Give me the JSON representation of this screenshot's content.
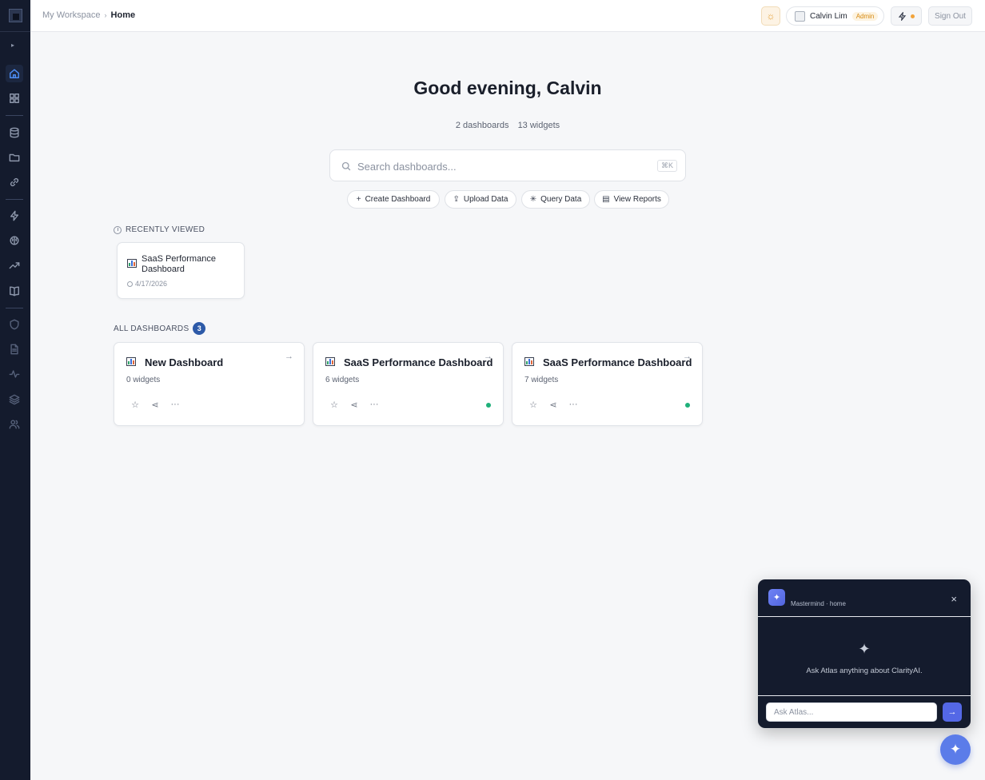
{
  "header": {
    "breadcrumb": {
      "workspace": "My Workspace",
      "separator": "›",
      "current": "Home"
    },
    "user": {
      "name": "Calvin Lim",
      "role": "Admin"
    },
    "sign_out": "Sign Out"
  },
  "main": {
    "greeting": "Good evening, Calvin",
    "stats": {
      "dashboards": "2 dashboards",
      "widgets": "13 widgets"
    },
    "search": {
      "placeholder": "Search dashboards...",
      "shortcut": "⌘K"
    },
    "actions": [
      {
        "label": "Create Dashboard",
        "icon": "plus-icon"
      },
      {
        "label": "Upload Data",
        "icon": "upload-icon"
      },
      {
        "label": "Query Data",
        "icon": "sparkle-icon"
      },
      {
        "label": "View Reports",
        "icon": "document-icon"
      }
    ],
    "recently_viewed": {
      "label": "RECENTLY VIEWED",
      "items": [
        {
          "title": "SaaS Performance Dashboard",
          "date": "4/17/2026"
        }
      ]
    },
    "all_dashboards": {
      "label": "ALL DASHBOARDS",
      "count": "3",
      "items": [
        {
          "title": "New Dashboard",
          "widgets": "0 widgets",
          "active": false
        },
        {
          "title": "SaaS Performance Dashboard",
          "widgets": "6 widgets",
          "active": true
        },
        {
          "title": "SaaS Performance Dashboard",
          "widgets": "7 widgets",
          "active": true
        }
      ]
    }
  },
  "chat": {
    "title": "Mastermind · home",
    "hint": "Ask Atlas anything about ClarityAI.",
    "input_placeholder": "Ask Atlas..."
  },
  "colors": {
    "sidebar_bg": "#141b2d",
    "accent": "#4d8ff7",
    "badge": "#2d5aa8",
    "status_green": "#1fb07a",
    "chat_send": "#5468e6"
  },
  "sidebar_icons": [
    "home-icon",
    "grid-icon",
    "database-icon",
    "folder-icon",
    "link-icon",
    "bolt-icon",
    "brain-icon",
    "trend-icon",
    "book-icon",
    "shield-icon",
    "document-icon",
    "activity-icon",
    "layers-icon",
    "users-icon"
  ]
}
